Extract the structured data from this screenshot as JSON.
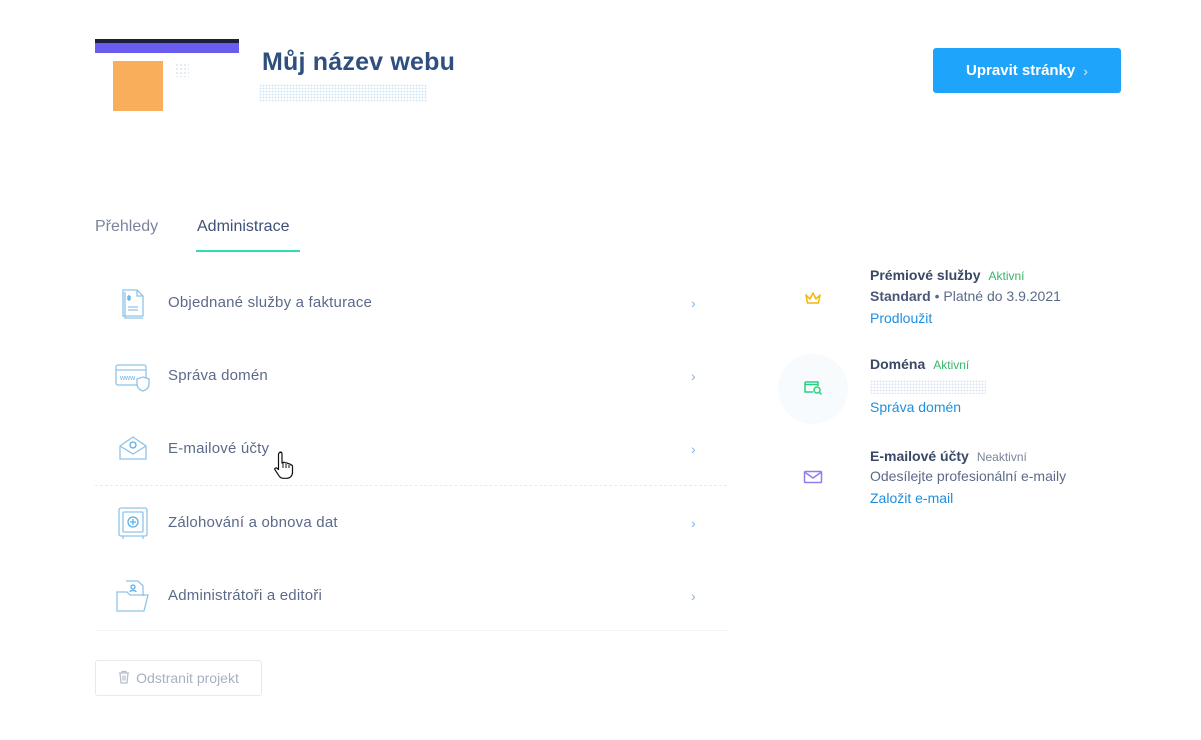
{
  "header": {
    "site_title": "Můj název webu",
    "edit_button_label": "Upravit stránky",
    "edit_button_chevron": "›"
  },
  "tabs": [
    {
      "label": "Přehledy",
      "active": false
    },
    {
      "label": "Administrace",
      "active": true
    }
  ],
  "admin_items": [
    {
      "label": "Objednané služby a fakturace",
      "icon": "invoice-icon",
      "arrow": "›"
    },
    {
      "label": "Správa domén",
      "icon": "domain-shield-icon",
      "arrow": "›"
    },
    {
      "label": "E-mailové účty",
      "icon": "email-envelope-icon",
      "arrow": "›"
    },
    {
      "label": "Zálohování a obnova dat",
      "icon": "safe-icon",
      "arrow": "›"
    },
    {
      "label": "Administrátoři a editoři",
      "icon": "folder-users-icon",
      "arrow": "›"
    }
  ],
  "remove_button_label": "Odstranit projekt",
  "services": {
    "premium": {
      "title": "Prémiové služby",
      "status": "Aktivní",
      "plan": "Standard",
      "separator": "•",
      "valid_until": "Platné do 3.9.2021",
      "link": "Prodloužit",
      "icon": "crown-icon"
    },
    "domain": {
      "title": "Doména",
      "status": "Aktivní",
      "link": "Správa domén",
      "icon": "domain-search-icon"
    },
    "email": {
      "title": "E-mailové účty",
      "status": "Neaktivní",
      "description": "Odesílejte profesionální e-maily",
      "link": "Založit e-mail",
      "icon": "envelope-icon"
    }
  },
  "colors": {
    "primary_button": "#1ea4fb",
    "tab_underline": "#36d8b2",
    "status_active": "#3ab56a",
    "link": "#1e8fe0",
    "crown": "#f2b705",
    "domain_icon": "#2ad17e",
    "envelope_icon": "#8b7ef0"
  }
}
